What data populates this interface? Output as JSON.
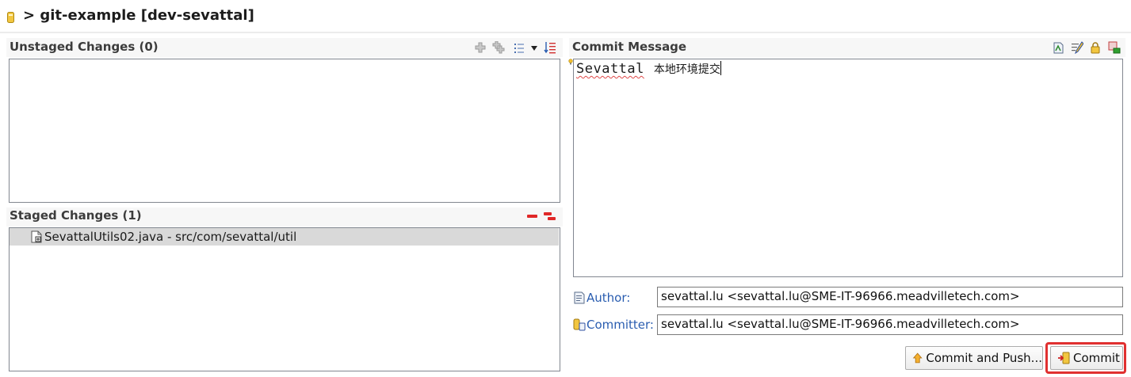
{
  "header": {
    "title": "> git-example [dev-sevattal]",
    "repo_icon": "repository-icon"
  },
  "unstaged": {
    "title": "Unstaged Changes (0)",
    "toolbar_icons": [
      "add-to-index-icon",
      "add-all-to-index-icon",
      "presentation-icon",
      "dropdown-arrow-icon",
      "sort-icon"
    ]
  },
  "staged": {
    "title": "Staged Changes (1)",
    "toolbar_icons": [
      "remove-from-index-icon",
      "remove-all-from-index-icon"
    ],
    "items": [
      {
        "label": "SevattalUtils02.java - src/com/sevattal/util",
        "icon": "java-file-icon"
      }
    ]
  },
  "commit": {
    "title": "Commit Message",
    "toolbar_icons": [
      "amend-icon",
      "signed-off-icon",
      "sign-commit-icon",
      "add-change-id-icon"
    ],
    "message_latin": "Sevattal",
    "message_cjk": "本地环境提交",
    "author_label": "Author:",
    "author_value": "sevattal.lu <sevattal.lu@SME-IT-96966.meadvilletech.com>",
    "committer_label": "Committer:",
    "committer_value": "sevattal.lu <sevattal.lu@SME-IT-96966.meadvilletech.com>",
    "commit_push_label": "Commit and Push...",
    "commit_label": "Commit"
  },
  "colors": {
    "highlight": "#e03030",
    "link": "#2a5db0",
    "selection": "#d9d9d9"
  }
}
